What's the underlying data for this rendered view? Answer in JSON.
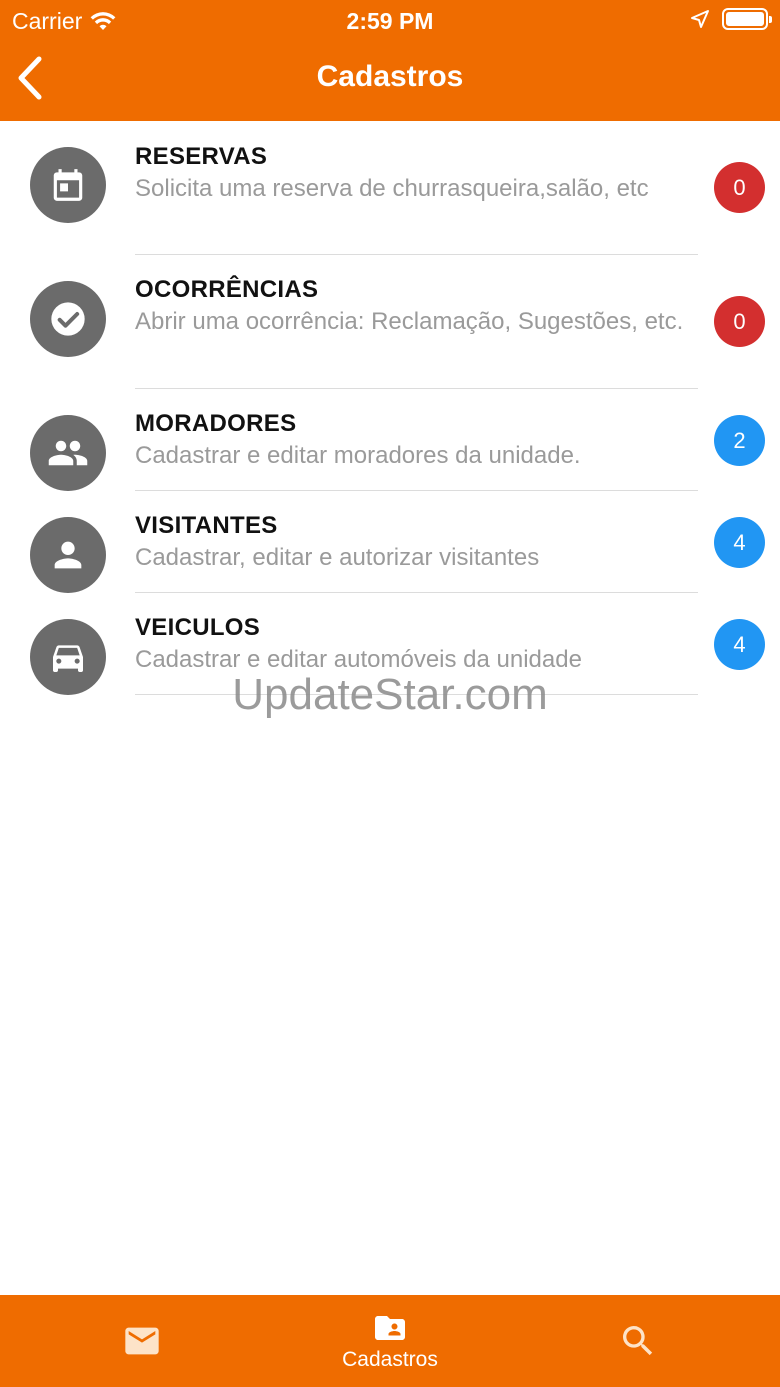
{
  "status_bar": {
    "carrier": "Carrier",
    "time": "2:59 PM"
  },
  "nav": {
    "title": "Cadastros"
  },
  "items": [
    {
      "title": "RESERVAS",
      "description": "Solicita uma reserva de churrasqueira,salão, etc",
      "badge": "0",
      "icon": "calendar-icon",
      "badge_color": "#d32f2f"
    },
    {
      "title": "OCORRÊNCIAS",
      "description": "Abrir uma ocorrência: Reclamação, Sugestões, etc.",
      "badge": "0",
      "icon": "check-circle-icon",
      "badge_color": "#d32f2f"
    },
    {
      "title": "MORADORES",
      "description": "Cadastrar e editar moradores da unidade.",
      "badge": "2",
      "icon": "people-icon",
      "badge_color": "#2196f3"
    },
    {
      "title": "VISITANTES",
      "description": "Cadastrar, editar e autorizar visitantes",
      "badge": "4",
      "icon": "person-icon",
      "badge_color": "#2196f3"
    },
    {
      "title": "VEICULOS",
      "description": "Cadastrar e editar automóveis da unidade",
      "badge": "4",
      "icon": "car-icon",
      "badge_color": "#2196f3"
    }
  ],
  "watermark": "UpdateStar.com",
  "tabbar": {
    "tabs": [
      {
        "label": "",
        "icon": "mail-icon"
      },
      {
        "label": "Cadastros",
        "icon": "folder-person-icon",
        "selected": true
      },
      {
        "label": "",
        "icon": "search-icon"
      }
    ]
  },
  "colors": {
    "accent": "#ef6c00",
    "badge_red": "#d32f2f",
    "badge_blue": "#2196f3",
    "icon_gray": "#6b6b6b"
  }
}
